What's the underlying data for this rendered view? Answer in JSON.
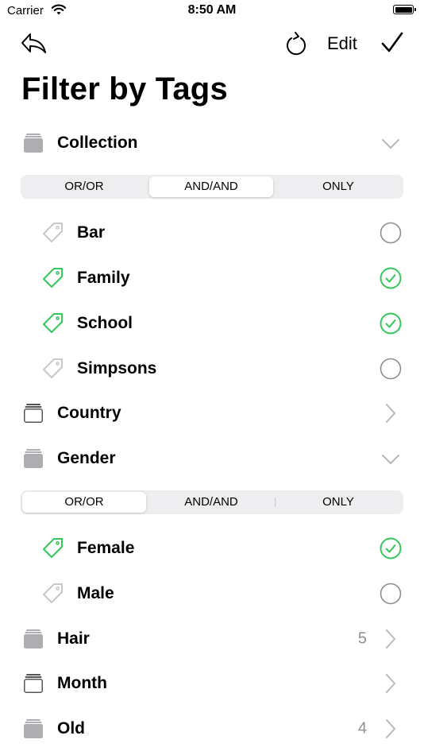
{
  "status_bar": {
    "carrier": "Carrier",
    "time": "8:50 AM"
  },
  "nav": {
    "edit_label": "Edit"
  },
  "page_title": "Filter by Tags",
  "segment_options": [
    "OR/OR",
    "AND/AND",
    "ONLY"
  ],
  "groups": [
    {
      "label": "Collection",
      "expanded": true,
      "filled": true,
      "selected_mode": "AND/AND",
      "tags": [
        {
          "label": "Bar",
          "checked": false
        },
        {
          "label": "Family",
          "checked": true
        },
        {
          "label": "School",
          "checked": true
        },
        {
          "label": "Simpsons",
          "checked": false
        }
      ]
    },
    {
      "label": "Country",
      "expanded": false,
      "filled": false,
      "count": ""
    },
    {
      "label": "Gender",
      "expanded": true,
      "filled": true,
      "selected_mode": "OR/OR",
      "tags": [
        {
          "label": "Female",
          "checked": true
        },
        {
          "label": "Male",
          "checked": false
        }
      ]
    },
    {
      "label": "Hair",
      "expanded": false,
      "filled": true,
      "count": "5"
    },
    {
      "label": "Month",
      "expanded": false,
      "filled": false,
      "count": ""
    },
    {
      "label": "Old",
      "expanded": false,
      "filled": true,
      "count": "4"
    }
  ],
  "colors": {
    "accent_green": "#34c759",
    "gray_icon": "#aeaeb2",
    "chevron": "#b8b8bd",
    "count_gray": "#8e8e93"
  }
}
